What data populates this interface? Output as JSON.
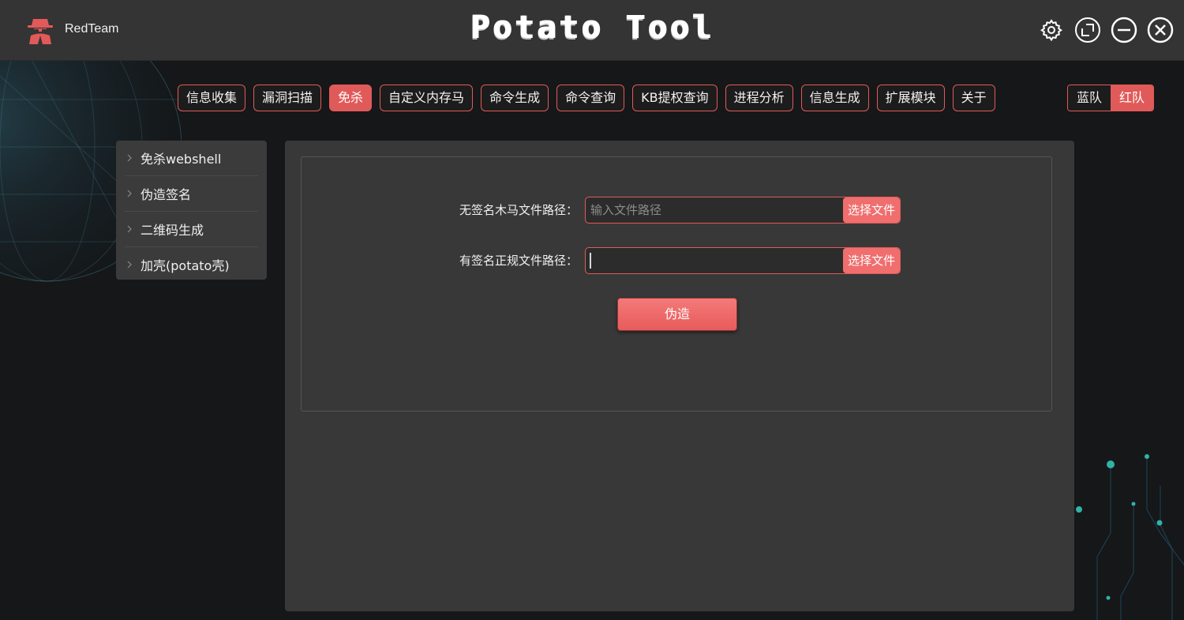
{
  "app": {
    "brand_name": "RedTeam",
    "title": "Potato Tool"
  },
  "window_buttons": [
    {
      "name": "settings-icon"
    },
    {
      "name": "maximize-icon"
    },
    {
      "name": "minimize-icon"
    },
    {
      "name": "close-icon"
    }
  ],
  "nav": {
    "active": "免杀",
    "tabs": [
      "信息收集",
      "漏洞扫描",
      "免杀",
      "自定义内存马",
      "命令生成",
      "命令查询",
      "KB提权查询",
      "进程分析",
      "信息生成",
      "扩展模块",
      "关于"
    ]
  },
  "team_switch": {
    "blue_label": "蓝队",
    "red_label": "红队",
    "active": "红队"
  },
  "sidebar": {
    "items": [
      {
        "label": "免杀webshell"
      },
      {
        "label": "伪造签名"
      },
      {
        "label": "二维码生成"
      },
      {
        "label": "加壳(potato壳)"
      }
    ]
  },
  "form": {
    "unsigned_label": "无签名木马文件路径：",
    "unsigned_placeholder": "输入文件路径",
    "unsigned_value": "",
    "signed_label": "有签名正规文件路径：",
    "signed_value": "",
    "choose_file_label": "选择文件",
    "forge_button": "伪造"
  },
  "colors": {
    "accent": "#e05a59",
    "button_light": "#f06e6e",
    "titlebar": "#343434",
    "panel": "#383838"
  }
}
